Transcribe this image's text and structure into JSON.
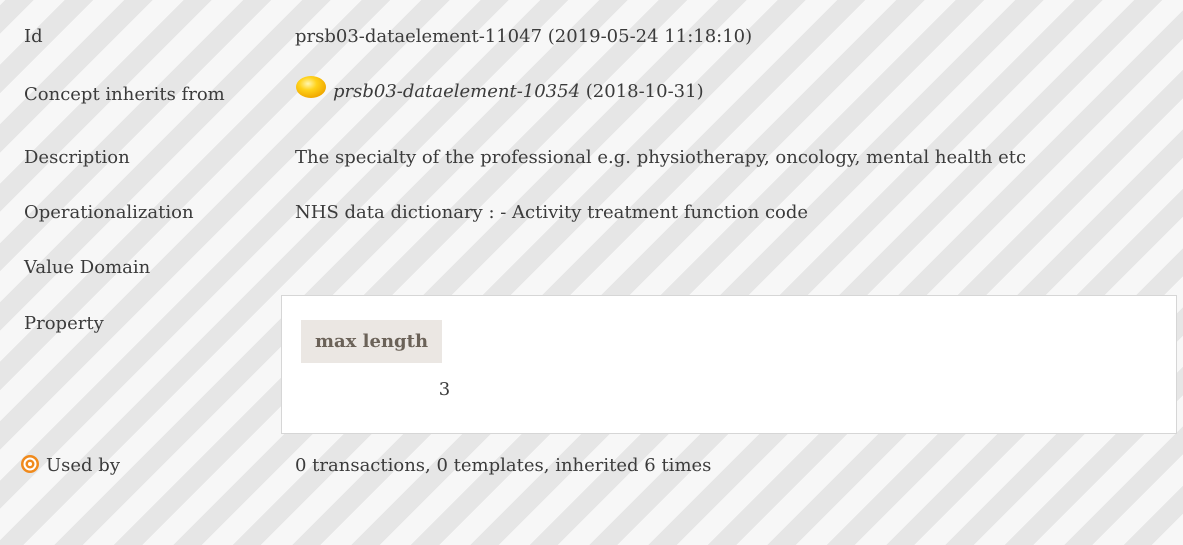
{
  "rows": {
    "id": {
      "label": "Id",
      "value": "prsb03-dataelement-11047 (2019-05-24 11:18:10)"
    },
    "inherits": {
      "label": "Concept inherits from",
      "link": "prsb03-dataelement-10354",
      "date": " (2018-10-31)"
    },
    "description": {
      "label": "Description",
      "value": "The specialty of the professional e.g. physiotherapy, oncology, mental health etc"
    },
    "operationalization": {
      "label": "Operationalization",
      "value": "NHS data dictionary : - Activity treatment function code"
    },
    "value_domain": {
      "label": "Value Domain"
    },
    "property": {
      "label": "Property",
      "header": "max length",
      "value": "3"
    },
    "used_by": {
      "label": "Used by",
      "value": "0 transactions, 0 templates, inherited 6 times"
    }
  },
  "icons": {
    "inherit": "yellow-ball-icon",
    "used_by": "target-icon"
  },
  "colors": {
    "inherit_icon": "#f7c400",
    "used_by_icon": "#f08a1c",
    "property_header_bg": "#ebe7e3",
    "property_header_text": "#6b6258"
  }
}
